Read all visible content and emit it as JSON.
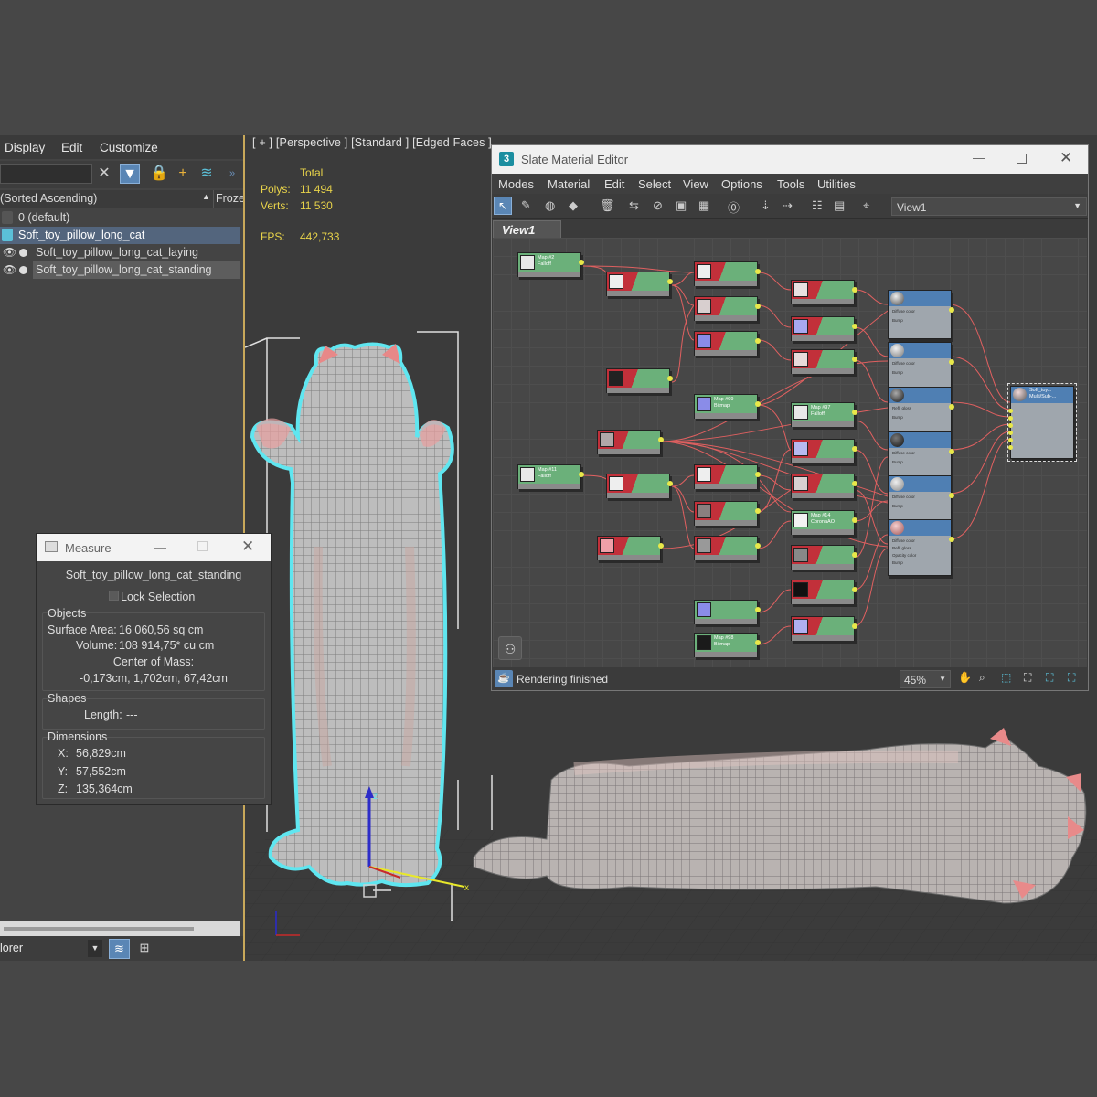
{
  "explorer": {
    "menu": [
      "Display",
      "Edit",
      "Customize"
    ],
    "header": {
      "sort_label": "(Sorted Ascending)",
      "frozen_label": "Froze"
    },
    "layers": [
      {
        "label": "0 (default)"
      },
      {
        "label": "Soft_toy_pillow_long_cat"
      },
      {
        "label": "Soft_toy_pillow_long_cat_laying"
      },
      {
        "label": "Soft_toy_pillow_long_cat_standing"
      }
    ],
    "bottom_label": "lorer"
  },
  "viewport": {
    "label": "[ + ] [Perspective ] [Standard ] [Edged Faces ]",
    "stats": {
      "total_label": "Total",
      "polys_label": "Polys:",
      "polys": "11 494",
      "verts_label": "Verts:",
      "verts": "11 530",
      "fps_label": "FPS:",
      "fps": "442,733"
    },
    "axis_x": "x",
    "axis_z": "z"
  },
  "measure": {
    "title": "Measure",
    "object_name": "Soft_toy_pillow_long_cat_standing",
    "lock_label": "Lock Selection",
    "objects_label": "Objects",
    "surface_label": "Surface Area:",
    "surface_value": "16 060,56 sq cm",
    "volume_label": "Volume:",
    "volume_value": "108 914,75* cu cm",
    "center_label": "Center of Mass:",
    "center_value": "-0,173cm, 1,702cm, 67,42cm",
    "shapes_label": "Shapes",
    "length_label": "Length:",
    "length_value": "---",
    "dimensions_label": "Dimensions",
    "x_label": "X:",
    "x_value": "56,829cm",
    "y_label": "Y:",
    "y_value": "57,552cm",
    "z_label": "Z:",
    "z_value": "135,364cm"
  },
  "slate": {
    "title": "Slate Material Editor",
    "menu": [
      "Modes",
      "Material",
      "Edit",
      "Select",
      "View",
      "Options",
      "Tools",
      "Utilities"
    ],
    "view_dropdown": "View1",
    "tab": "View1",
    "status": "Rendering finished",
    "zoom": "45%",
    "nodes": [
      {
        "name": "Map #2\nFalloff",
        "color": "#6bb07a",
        "swatch": "#dcdcdc"
      },
      {
        "name": "Map #11\nFalloff",
        "color": "#6bb07a",
        "swatch": "#dcdcdc"
      },
      {
        "name": "Map #97\nFalloff",
        "color": "#6bb07a",
        "swatch": "#dcdcdc"
      },
      {
        "name": "Map #14\nCoronaAO",
        "color": "#6bb07a",
        "swatch": "#f2f2f2"
      },
      {
        "name": "Map #99\nBitmap",
        "color": "#6bb07a",
        "swatch": "#8a8ce8"
      },
      {
        "name": "Map #98\nBitmap",
        "color": "#6bb07a",
        "swatch": "#1a1a1a"
      }
    ],
    "materials": [
      {
        "name": "Soft_toy...\nMulti/Sub-..."
      }
    ]
  }
}
